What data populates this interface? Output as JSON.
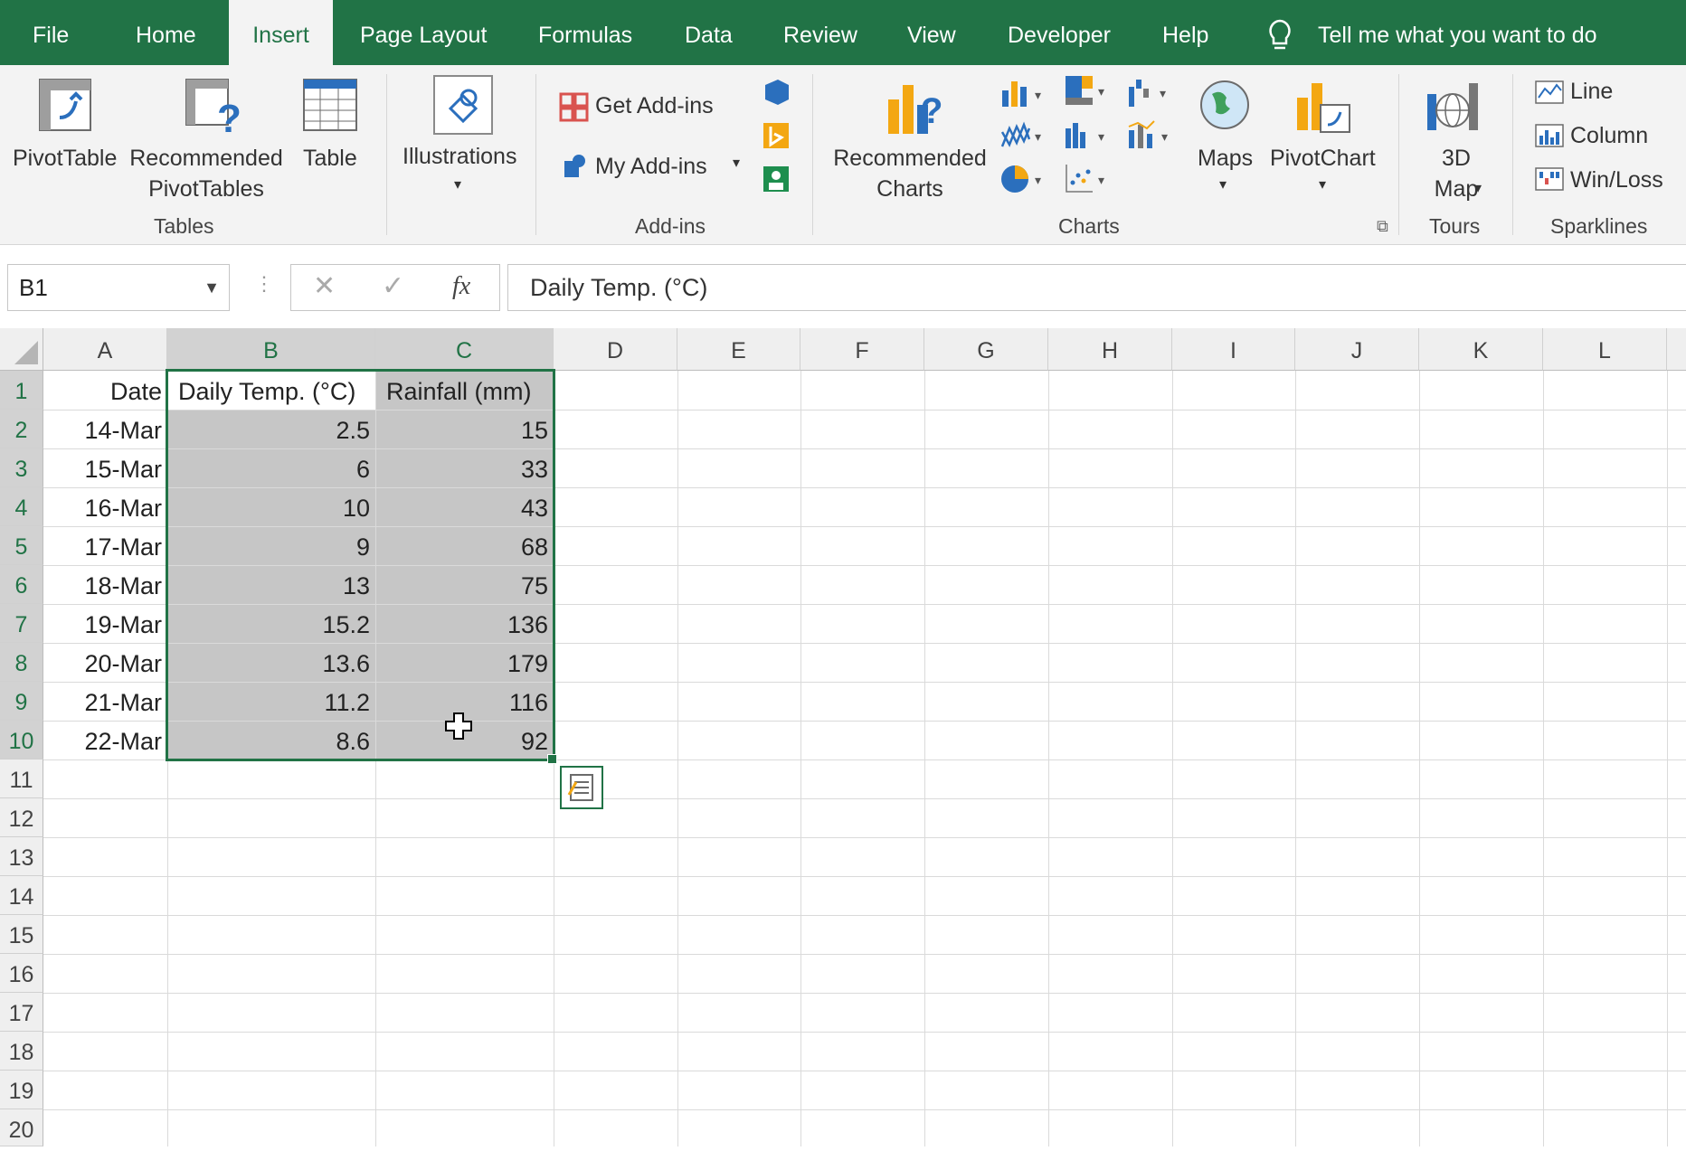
{
  "tabs": [
    "File",
    "Home",
    "Insert",
    "Page Layout",
    "Formulas",
    "Data",
    "Review",
    "View",
    "Developer",
    "Help"
  ],
  "active_tab": "Insert",
  "tell_me": "Tell me what you want to do",
  "ribbon": {
    "pivottable": "PivotTable",
    "recommended_pivot_1": "Recommended",
    "recommended_pivot_2": "PivotTables",
    "table": "Table",
    "tables_group": "Tables",
    "illustrations": "Illustrations",
    "get_addins": "Get Add-ins",
    "my_addins": "My Add-ins",
    "addins_group": "Add-ins",
    "recommended_charts_1": "Recommended",
    "recommended_charts_2": "Charts",
    "charts_group": "Charts",
    "maps": "Maps",
    "pivotchart": "PivotChart",
    "map3d_1": "3D",
    "map3d_2": "Map",
    "tours_group": "Tours",
    "sparkline_line": "Line",
    "sparkline_column": "Column",
    "sparkline_winloss": "Win/Loss",
    "sparklines_group": "Sparklines"
  },
  "formula_bar": {
    "name_box": "B1",
    "fx_label": "fx",
    "formula": "Daily Temp. (°C)"
  },
  "columns": [
    "A",
    "B",
    "C",
    "D",
    "E",
    "F",
    "G",
    "H",
    "I",
    "J",
    "K",
    "L"
  ],
  "rows": [
    "1",
    "2",
    "3",
    "4",
    "5",
    "6",
    "7",
    "8",
    "9",
    "10",
    "11",
    "12",
    "13",
    "14",
    "15",
    "16",
    "17",
    "18",
    "19",
    "20"
  ],
  "sheet": {
    "headers": [
      "Date",
      "Daily Temp. (°C)",
      "Rainfall (mm)"
    ],
    "data": [
      [
        "14-Mar",
        "2.5",
        "15"
      ],
      [
        "15-Mar",
        "6",
        "33"
      ],
      [
        "16-Mar",
        "10",
        "43"
      ],
      [
        "17-Mar",
        "9",
        "68"
      ],
      [
        "18-Mar",
        "13",
        "75"
      ],
      [
        "19-Mar",
        "15.2",
        "136"
      ],
      [
        "20-Mar",
        "13.6",
        "179"
      ],
      [
        "21-Mar",
        "11.2",
        "116"
      ],
      [
        "22-Mar",
        "8.6",
        "92"
      ]
    ]
  },
  "selection": "B1:C10",
  "accent_color": "#217346"
}
